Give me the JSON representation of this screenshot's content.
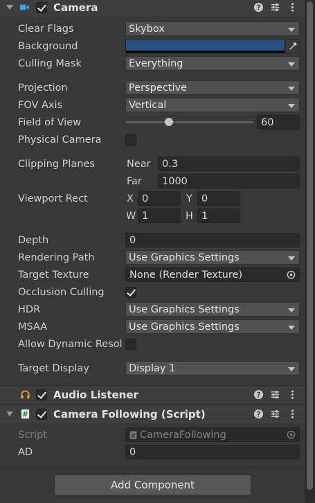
{
  "camera": {
    "title": "Camera",
    "clear_flags_label": "Clear Flags",
    "clear_flags_value": "Skybox",
    "background_label": "Background",
    "background_color": "#2b4f80",
    "culling_mask_label": "Culling Mask",
    "culling_mask_value": "Everything",
    "projection_label": "Projection",
    "projection_value": "Perspective",
    "fov_axis_label": "FOV Axis",
    "fov_axis_value": "Vertical",
    "fov_label": "Field of View",
    "fov_value": "60",
    "physical_camera_label": "Physical Camera",
    "physical_camera_checked": false,
    "clipping_planes_label": "Clipping Planes",
    "near_label": "Near",
    "near_value": "0.3",
    "far_label": "Far",
    "far_value": "1000",
    "viewport_rect_label": "Viewport Rect",
    "x_label": "X",
    "x_value": "0",
    "y_label": "Y",
    "y_value": "0",
    "w_label": "W",
    "w_value": "1",
    "h_label": "H",
    "h_value": "1",
    "depth_label": "Depth",
    "depth_value": "0",
    "rendering_path_label": "Rendering Path",
    "rendering_path_value": "Use Graphics Settings",
    "target_texture_label": "Target Texture",
    "target_texture_value": "None (Render Texture)",
    "occlusion_culling_label": "Occlusion Culling",
    "occlusion_culling_checked": true,
    "hdr_label": "HDR",
    "hdr_value": "Use Graphics Settings",
    "msaa_label": "MSAA",
    "msaa_value": "Use Graphics Settings",
    "allow_dynamic_label": "Allow Dynamic Resol",
    "allow_dynamic_checked": false,
    "target_display_label": "Target Display",
    "target_display_value": "Display 1"
  },
  "audio_listener": {
    "title": "Audio Listener"
  },
  "camera_following": {
    "title": "Camera Following (Script)",
    "script_label": "Script",
    "script_value": "CameraFollowing",
    "ad_label": "AD",
    "ad_value": "0"
  },
  "add_component_label": "Add Component",
  "icons": {
    "camera": "camera-icon",
    "help": "help-icon",
    "presets": "presets-icon",
    "menu": "kebab-menu-icon",
    "eyedropper": "eyedropper-icon",
    "object_picker": "object-picker-icon",
    "audio": "headphones-icon",
    "script": "script-icon"
  }
}
